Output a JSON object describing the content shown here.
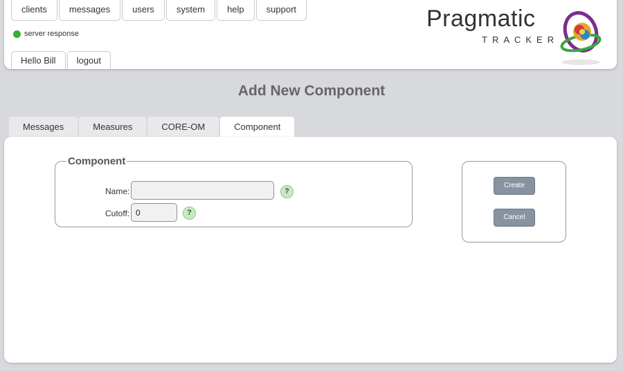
{
  "nav": {
    "items": [
      "clients",
      "messages",
      "users",
      "system",
      "help",
      "support"
    ]
  },
  "status": {
    "text": "server response",
    "color": "#35b034"
  },
  "user_nav": {
    "greeting": "Hello Bill",
    "logout": "logout"
  },
  "logo": {
    "word": "Pragmatic",
    "sub": "TRACKER",
    "icon": "swirl-logo-icon"
  },
  "page": {
    "title": "Add New Component"
  },
  "tabs": [
    "Messages",
    "Measures",
    "CORE-OM",
    "Component"
  ],
  "form": {
    "legend": "Component",
    "name_label": "Name:",
    "name_value": "",
    "cutoff_label": "Cutoff:",
    "cutoff_value": "0",
    "help_glyph": "?"
  },
  "actions": {
    "create": "Create",
    "cancel": "Cancel"
  }
}
